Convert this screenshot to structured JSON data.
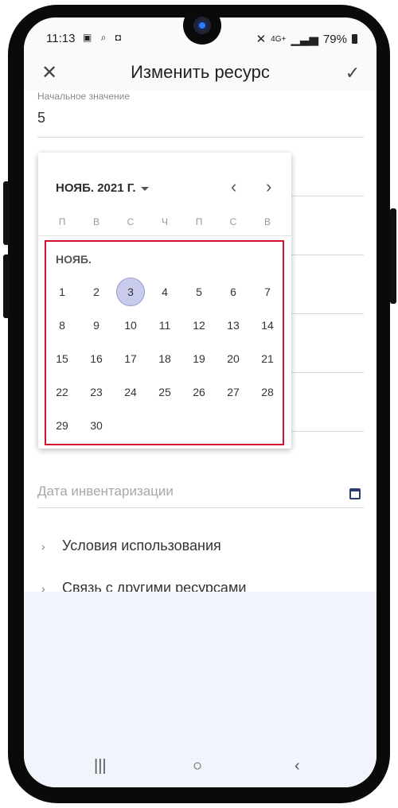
{
  "status_bar": {
    "time": "11:13",
    "left_icons": "▣ ⌕ ◘",
    "network": "4G+",
    "signal": "▁▃▅",
    "battery": "79%"
  },
  "app_bar": {
    "title": "Изменить ресурс",
    "close_icon": "✕",
    "confirm_icon": "✓"
  },
  "form": {
    "initial_value_label": "Начальное значение",
    "initial_value": "5",
    "inventory_date_placeholder": "Дата инвентаризации",
    "sections": [
      {
        "label": "Условия использования"
      },
      {
        "label": "Связь с другими ресурсами"
      }
    ]
  },
  "date_picker": {
    "month_year": "НОЯБ. 2021 Г.",
    "month_label": "НОЯБ.",
    "weekdays": [
      "П",
      "В",
      "С",
      "Ч",
      "П",
      "С",
      "В"
    ],
    "selected_day": "3",
    "prev_icon": "‹",
    "next_icon": "›",
    "days": [
      "1",
      "2",
      "3",
      "4",
      "5",
      "6",
      "7",
      "8",
      "9",
      "10",
      "11",
      "12",
      "13",
      "14",
      "15",
      "16",
      "17",
      "18",
      "19",
      "20",
      "21",
      "22",
      "23",
      "24",
      "25",
      "26",
      "27",
      "28",
      "29",
      "30"
    ]
  },
  "nav_bar": {
    "recents": "|||",
    "home": "○",
    "back": "‹"
  },
  "colors": {
    "accent": "#2b3a73",
    "selected_day_bg": "#c9cbec",
    "highlight_border": "#d3102b",
    "empty_area_bg": "#f1f4fb"
  }
}
